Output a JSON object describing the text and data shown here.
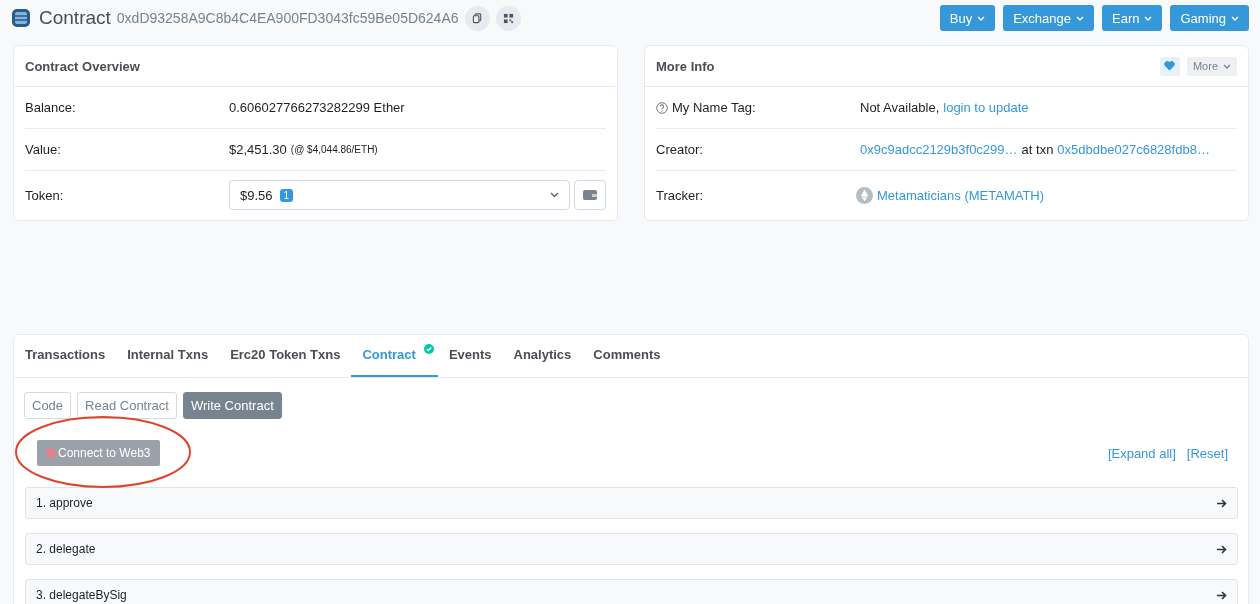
{
  "header": {
    "title": "Contract",
    "address": "0xdD93258A9C8b4C4EA900FD3043fc59Be05D624A6",
    "menus": [
      "Buy",
      "Exchange",
      "Earn",
      "Gaming"
    ]
  },
  "overview": {
    "title": "Contract Overview",
    "balance_label": "Balance:",
    "balance": "0.606027766273282299 Ether",
    "value_label": "Value:",
    "value": "$2,451.30",
    "value_rate": "(@ $4,044.86/ETH)",
    "token_label": "Token:",
    "token_value": "$9.56",
    "token_count": "1"
  },
  "more_info": {
    "title": "More Info",
    "more_button": "More",
    "name_tag_label": "My Name Tag:",
    "name_tag_value": "Not Available,",
    "name_tag_link": "login to update",
    "creator_label": "Creator:",
    "creator": "0x9c9adcc2129b3f0c299…",
    "at_txn": "at txn",
    "txn": "0x5dbdbe027c6828fdb8…",
    "tracker_label": "Tracker:",
    "tracker": "Metamaticians (METAMATH)"
  },
  "tabs": [
    {
      "label": "Transactions",
      "selected": false,
      "verified": false
    },
    {
      "label": "Internal Txns",
      "selected": false,
      "verified": false
    },
    {
      "label": "Erc20 Token Txns",
      "selected": false,
      "verified": false
    },
    {
      "label": "Contract",
      "selected": true,
      "verified": true
    },
    {
      "label": "Events",
      "selected": false,
      "verified": false
    },
    {
      "label": "Analytics",
      "selected": false,
      "verified": false
    },
    {
      "label": "Comments",
      "selected": false,
      "verified": false
    }
  ],
  "sub_tabs": [
    {
      "label": "Code",
      "selected": false
    },
    {
      "label": "Read Contract",
      "selected": false
    },
    {
      "label": "Write Contract",
      "selected": true
    }
  ],
  "connect_button": "Connect to Web3",
  "expand_all": "[Expand all]",
  "reset": "[Reset]",
  "functions": [
    "1. approve",
    "2. delegate",
    "3. delegateBySig"
  ]
}
